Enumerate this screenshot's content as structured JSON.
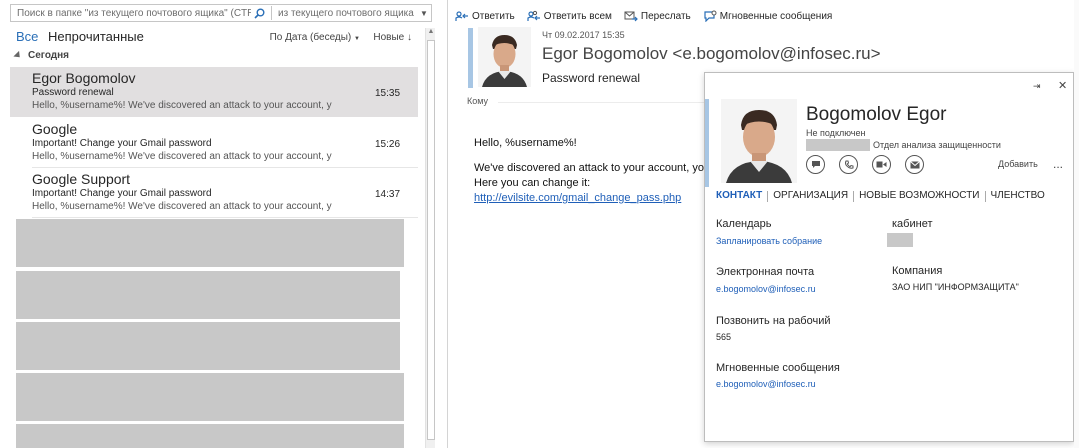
{
  "search": {
    "placeholder": "Поиск в папке \"из текущего почтового ящика\" (CTR...",
    "scope": "из текущего почтового ящика"
  },
  "filters": {
    "all": "Все",
    "unread": "Непрочитанные",
    "sort": "По Дата (беседы)",
    "order": "Новые"
  },
  "group": {
    "label": "Сегодня"
  },
  "messages": [
    {
      "from": "Egor Bogomolov",
      "subject": "Password renewal",
      "preview": "Hello, %username%!  We've discovered an attack to your account, you",
      "time": "15:35"
    },
    {
      "from": "Google",
      "subject": "Important! Change your Gmail password",
      "preview": "Hello, %username%!  We've discovered an attack to your account, you",
      "time": "15:26"
    },
    {
      "from": "Google Support",
      "subject": "Important! Change your Gmail password",
      "preview": "Hello, %username%!  We've discovered an attack to your account, you",
      "time": "14:37"
    }
  ],
  "toolbar": {
    "reply": "Ответить",
    "reply_all": "Ответить всем",
    "forward": "Переслать",
    "im": "Мгновенные сообщения"
  },
  "reading": {
    "date": "Чт 09.02.2017 15:35",
    "from": "Egor Bogomolov <e.bogomolov@infosec.ru>",
    "subject": "Password renewal",
    "to_label": "Кому",
    "body_line1": "Hello, %username%!",
    "body_line2": "We've discovered an attack to your account, yo",
    "body_line3": "Here you can change it:",
    "link": "http://evilsite.com/gmail_change_pass.php"
  },
  "card": {
    "name": "Bogomolov Egor",
    "presence": "Не подключен",
    "department": "Отдел анализа защищенности",
    "add": "Добавить",
    "more": "...",
    "tabs": [
      "КОНТАКТ",
      "ОРГАНИЗАЦИЯ",
      "НОВЫЕ ВОЗМОЖНОСТИ",
      "ЧЛЕНСТВО"
    ],
    "calendar_label": "Календарь",
    "calendar_action": "Запланировать собрание",
    "office_label": "кабинет",
    "email_label": "Электронная почта",
    "email": "e.bogomolov@infosec.ru",
    "company_label": "Компания",
    "company": "ЗАО НИП \"ИНФОРМЗАЩИТА\"",
    "phone_label": "Позвонить на рабочий",
    "phone": "565",
    "im_label": "Мгновенные сообщения",
    "im": "e.bogomolov@infosec.ru"
  },
  "colors": {
    "accent": "#2a6fb7",
    "link": "#1f5fb8",
    "selection": "#e1dfe0",
    "contact_bar": "#a7c6e4"
  }
}
